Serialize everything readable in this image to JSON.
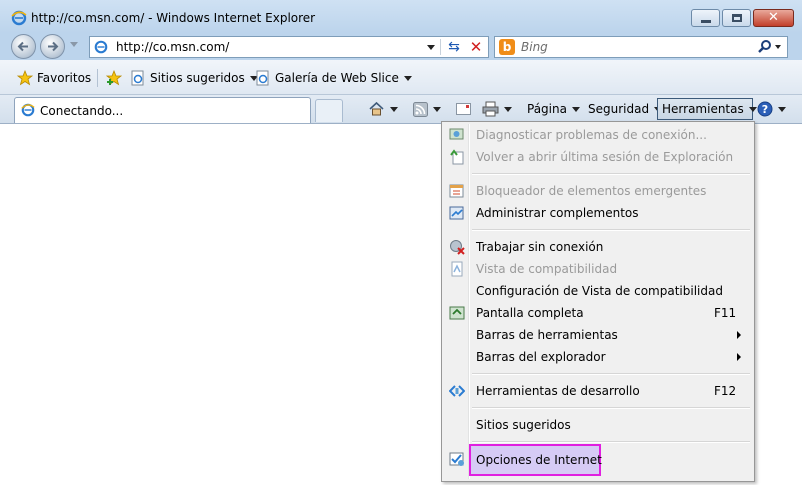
{
  "window": {
    "title": "http://co.msn.com/ - Windows Internet Explorer"
  },
  "address": {
    "url": "http://co.msn.com/"
  },
  "search": {
    "placeholder": "Bing"
  },
  "favorites_bar": {
    "favorites_label": "Favoritos",
    "suggested_sites": "Sitios sugeridos",
    "web_slice_gallery": "Galería de Web Slice"
  },
  "tab": {
    "label": "Conectando..."
  },
  "command_bar": {
    "page": "Página",
    "safety": "Seguridad",
    "tools": "Herramientas"
  },
  "tools_menu": {
    "items": [
      {
        "label": "Diagnosticar problemas de conexión...",
        "enabled": false,
        "icon": "diagnose-icon"
      },
      {
        "label": "Volver a abrir última sesión de Exploración",
        "enabled": false,
        "icon": "reopen-session-icon"
      },
      {
        "label": "Bloqueador de elementos emergentes",
        "enabled": false,
        "icon": "popup-blocker-icon"
      },
      {
        "label": "Administrar complementos",
        "enabled": true,
        "icon": "addons-icon"
      },
      {
        "label": "Trabajar sin conexión",
        "enabled": true,
        "icon": "offline-icon"
      },
      {
        "label": "Vista de compatibilidad",
        "enabled": false,
        "icon": "compatibility-icon"
      },
      {
        "label": "Configuración de Vista de compatibilidad",
        "enabled": true
      },
      {
        "label": "Pantalla completa",
        "enabled": true,
        "shortcut": "F11",
        "icon": "fullscreen-icon"
      },
      {
        "label": "Barras de herramientas",
        "enabled": true,
        "submenu": true
      },
      {
        "label": "Barras del explorador",
        "enabled": true,
        "submenu": true
      },
      {
        "label": "Herramientas de desarrollo",
        "enabled": true,
        "shortcut": "F12",
        "icon": "developer-tools-icon"
      },
      {
        "label": "Sitios sugeridos",
        "enabled": true
      },
      {
        "label": "Opciones de Internet",
        "enabled": true,
        "highlighted": true,
        "icon": "internet-options-icon"
      }
    ]
  },
  "colors": {
    "highlight_outline": "#e020e0",
    "highlight_fill": "#d6cbf5"
  }
}
